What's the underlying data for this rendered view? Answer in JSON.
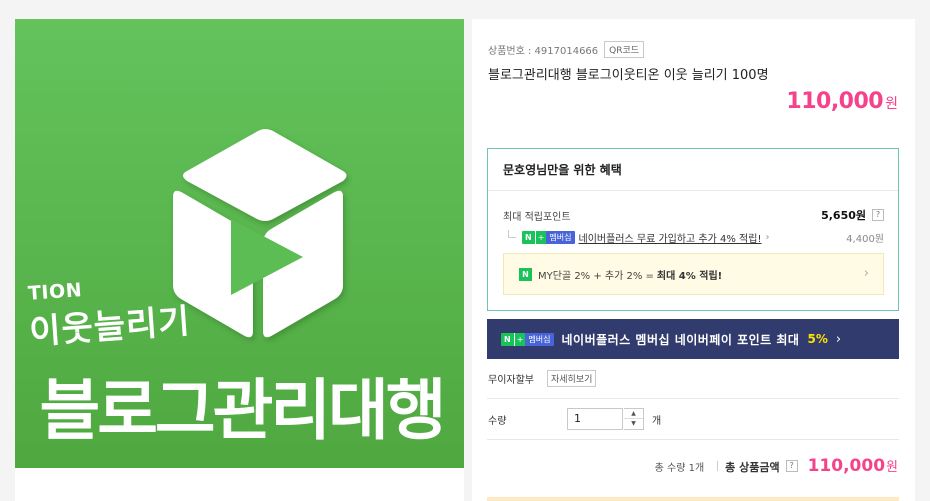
{
  "image": {
    "small_text": "TION",
    "mid_text": "이웃늘리기",
    "big_text": "블로그관리대행"
  },
  "product": {
    "code_label": "상품번호 : 4917014666",
    "qr_label": "QR코드",
    "title": "블로그관리대행 블로그이웃티온 이웃 늘리기 100명",
    "price": "110,000",
    "price_unit": "원"
  },
  "benefit": {
    "title": "문호영님만을 위한 혜택",
    "max_label": "최대 적립포인트",
    "max_value": "5,650원",
    "help": "?",
    "badge_n": "N",
    "badge_plus": "+",
    "badge_member": "멤버십",
    "plus_text": "네이버플러스 무료 가입하고 추가 4% 적립!",
    "plus_amount": "4,400원",
    "my_prefix": "MY단골 2% + 추가 2% = ",
    "my_bold": "최대 4% 적립!",
    "arrow": "›"
  },
  "banner": {
    "text": "네이버플러스 멤버십 네이버페이 포인트 최대",
    "percent": "5%",
    "arrow": "›"
  },
  "installment": {
    "label": "무이자할부",
    "detail": "자세히보기"
  },
  "quantity": {
    "label": "수량",
    "value": "1",
    "unit": "개",
    "up": "▲",
    "down": "▼"
  },
  "total": {
    "qty_text": "총 수량 1개",
    "label": "총 상품금액",
    "help": "?",
    "price": "110,000",
    "unit": "원"
  },
  "colors": {
    "green_bg": "#5cbd54",
    "price_pink": "#f5428b",
    "banner_navy": "#323b6e",
    "naver_green": "#19c35a"
  }
}
